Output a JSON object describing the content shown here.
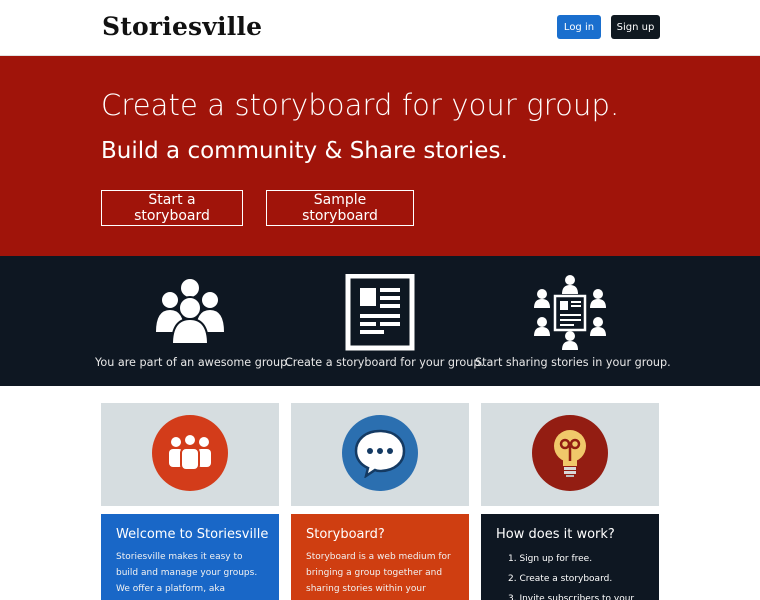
{
  "header": {
    "logo": "Storiesville",
    "login_label": "Log in",
    "signup_label": "Sign up"
  },
  "hero": {
    "title": "Create a storyboard for your group.",
    "subtitle": "Build a community & Share stories.",
    "start_label": "Start a storyboard",
    "sample_label": "Sample storyboard"
  },
  "features": [
    {
      "icon": "group-icon",
      "caption": "You are part of an awesome group."
    },
    {
      "icon": "storyboard-icon",
      "caption": "Create a storyboard for your group."
    },
    {
      "icon": "sharing-icon",
      "caption": "Start sharing stories in your group."
    }
  ],
  "cards": [
    {
      "icon": "people-icon",
      "title": "Welcome to Storiesville",
      "text": "Storiesville makes it easy to build and manage your groups. We offer a platform, aka Storyboard, for your group to create posts and stay..."
    },
    {
      "icon": "chat-bubble-icon",
      "title": "Storyboard?",
      "text": "Storyboard is a web medium for bringing a group together and sharing stories within your community."
    },
    {
      "icon": "lightbulb-icon",
      "title": "How does it work?",
      "steps": [
        "1. Sign up for free.",
        "2. Create a storyboard.",
        "3. Invite subscribers to your"
      ]
    }
  ],
  "colors": {
    "hero": "#a0140a",
    "dark": "#0e1722",
    "blue": "#1967c7",
    "orange": "#cf3e11"
  }
}
